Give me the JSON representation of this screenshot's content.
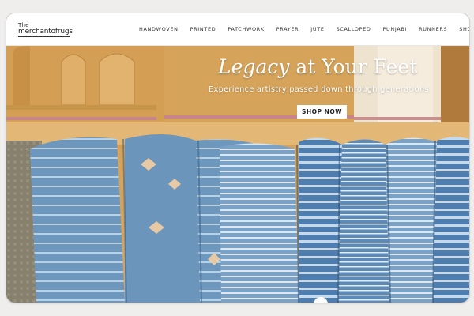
{
  "brand": {
    "line1": "The",
    "line2": "merchantofrugs"
  },
  "nav": {
    "items": [
      "HANDWOVEN",
      "PRINTED",
      "PATCHWORK",
      "PRAYER",
      "JUTE",
      "SCALLOPED",
      "PUNJABI",
      "RUNNERS",
      "SHOP BY"
    ]
  },
  "hero": {
    "title_italic": "Legacy",
    "title_rest": " at Your Feet",
    "subtitle": "Experience artistry passed down through generations",
    "cta": "SHOP NOW"
  },
  "colors": {
    "wall": "#d9a85b",
    "rug_blue": "#6f97bd",
    "accent_pink": "#c9858c"
  }
}
